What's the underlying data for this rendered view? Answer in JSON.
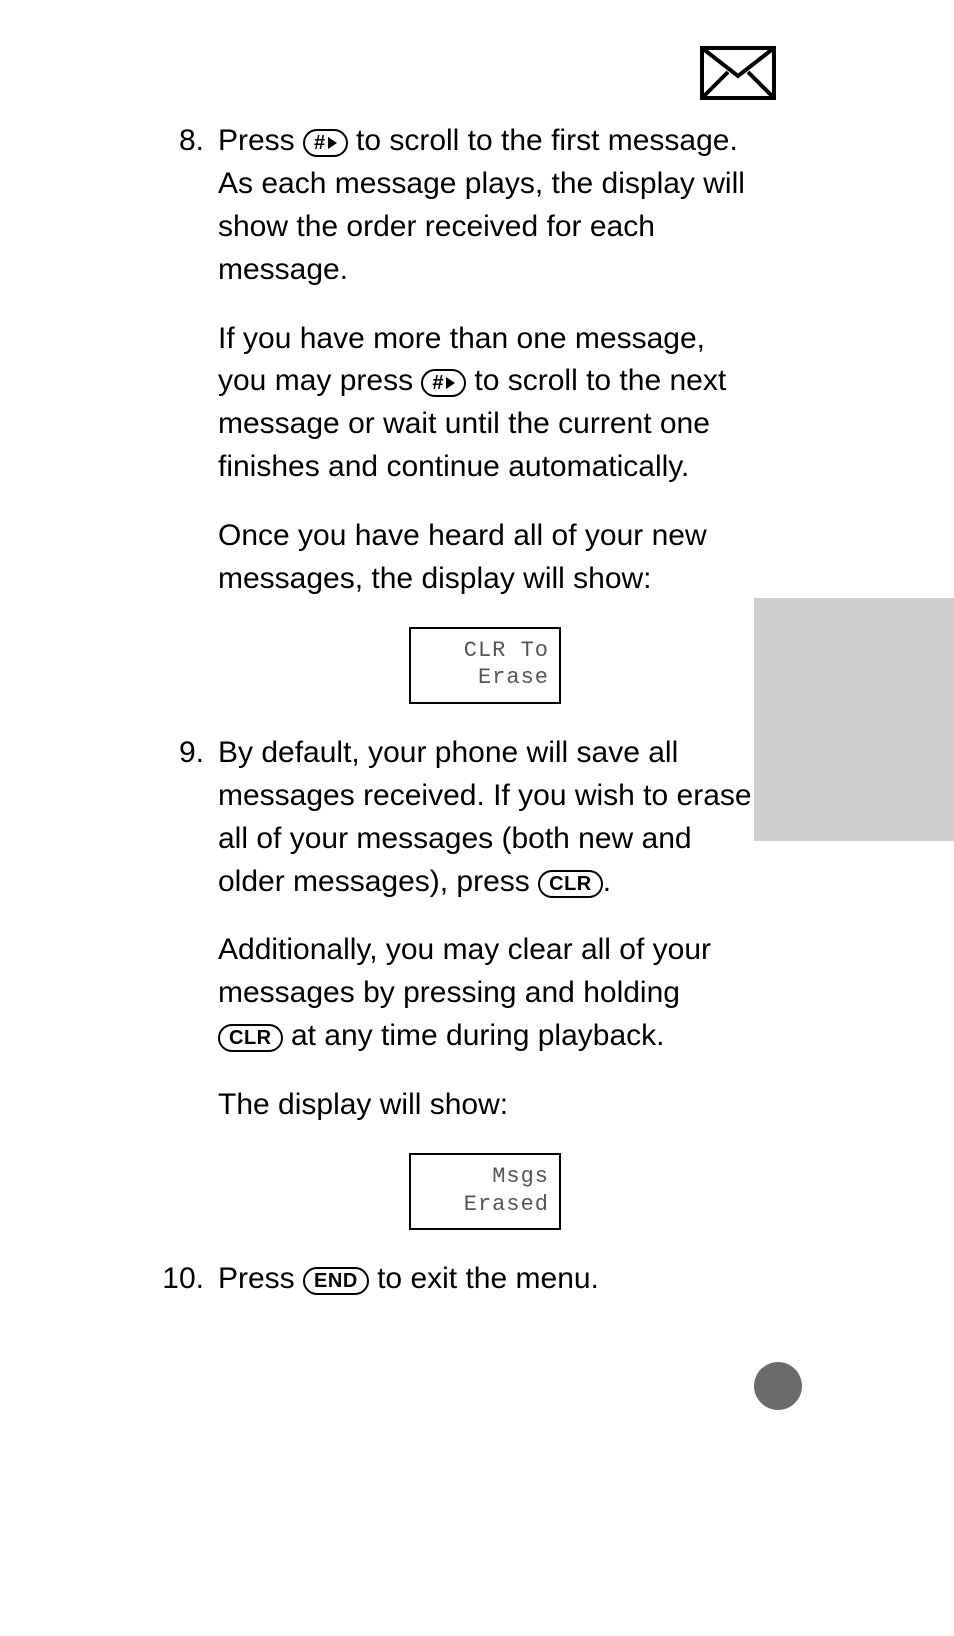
{
  "steps": [
    {
      "num": "8.",
      "p1_a": "Press ",
      "p1_b": " to scroll to the first message. As each message plays, the display will show the order received for each message.",
      "p2_a": "If you have more than one message, you may press ",
      "p2_b": " to scroll to the next message or wait until the current one finishes and continue automatically.",
      "p3": "Once you have heard all of your new messages, the display will show:",
      "lcd1_line1": "CLR To",
      "lcd1_line2": "Erase"
    },
    {
      "num": "9.",
      "p1_a": "By default, your phone will save all messages received. If you wish to erase all of your messages (both new and older messages), press ",
      "p1_b": ".",
      "p2_a": "Additionally, you may clear all of your messages by pressing and holding ",
      "p2_b": " at any time during playback.",
      "p3": "The display will show:",
      "lcd2_line1": "Msgs",
      "lcd2_line2": "Erased"
    },
    {
      "num": "10.",
      "p1_a": "Press ",
      "p1_b": " to exit the menu."
    }
  ],
  "keys": {
    "hash": "#",
    "clr": "CLR",
    "end": "END"
  }
}
